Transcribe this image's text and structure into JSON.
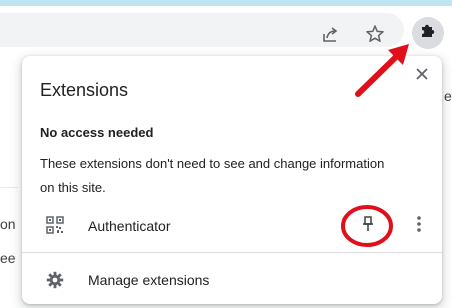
{
  "popup": {
    "title": "Extensions",
    "section_heading": "No access needed",
    "section_description": "These extensions don't need to see and change information on this site.",
    "extensions": [
      {
        "name": "Authenticator",
        "pinned": false
      }
    ],
    "manage_label": "Manage extensions"
  },
  "background": {
    "left_fragment_1": "on",
    "left_fragment_2": "ee",
    "right_fragment_1": "er"
  },
  "toolbar": {
    "icons": [
      "share-icon",
      "star-icon",
      "puzzle-extensions-icon"
    ]
  },
  "annotations": {
    "color": "#e0101a"
  }
}
